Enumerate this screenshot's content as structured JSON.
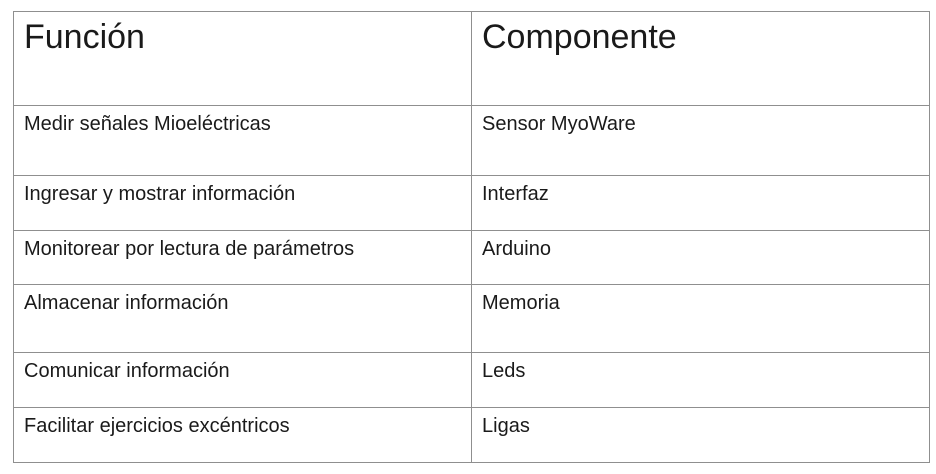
{
  "table": {
    "headers": [
      "Función",
      "Componente"
    ],
    "rows": [
      [
        "Medir señales Mioeléctricas",
        "Sensor MyoWare"
      ],
      [
        "Ingresar y mostrar información",
        "Interfaz"
      ],
      [
        "Monitorear por lectura de parámetros",
        "Arduino"
      ],
      [
        "Almacenar información",
        "Memoria"
      ],
      [
        "Comunicar información",
        "Leds"
      ],
      [
        "Facilitar ejercicios excéntricos",
        "Ligas"
      ]
    ]
  }
}
